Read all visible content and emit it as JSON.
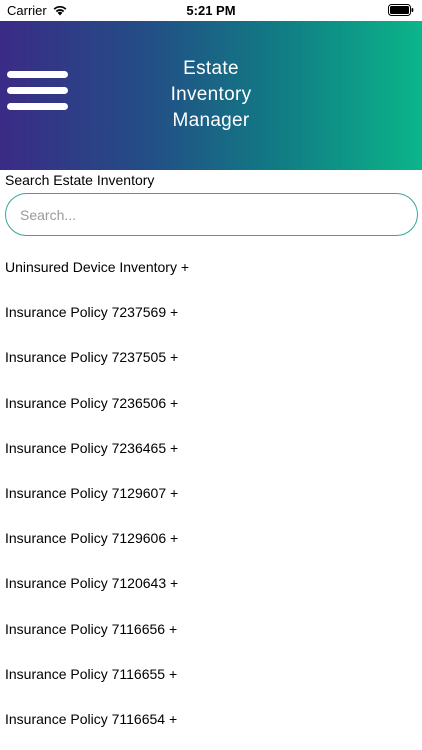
{
  "status_bar": {
    "carrier": "Carrier",
    "time": "5:21 PM",
    "wifi_icon": "wifi-icon",
    "battery_icon": "battery-icon"
  },
  "header": {
    "title_lines": [
      "Estate",
      "Inventory",
      "Manager"
    ],
    "menu_icon": "hamburger-menu-icon",
    "gradient_start": "#3a2b86",
    "gradient_end": "#0bb58a"
  },
  "search": {
    "label": "Search Estate Inventory",
    "placeholder": "Search...",
    "value": "",
    "border_color": "#3aa49a"
  },
  "inventory_list": [
    {
      "label": "Uninsured Device Inventory +"
    },
    {
      "label": "Insurance Policy 7237569 +"
    },
    {
      "label": "Insurance Policy 7237505 +"
    },
    {
      "label": "Insurance Policy 7236506 +"
    },
    {
      "label": "Insurance Policy 7236465 +"
    },
    {
      "label": "Insurance Policy 7129607 +"
    },
    {
      "label": "Insurance Policy 7129606 +"
    },
    {
      "label": "Insurance Policy 7120643 +"
    },
    {
      "label": "Insurance Policy 7116656 +"
    },
    {
      "label": "Insurance Policy 7116655 +"
    },
    {
      "label": "Insurance Policy 7116654 +"
    }
  ]
}
